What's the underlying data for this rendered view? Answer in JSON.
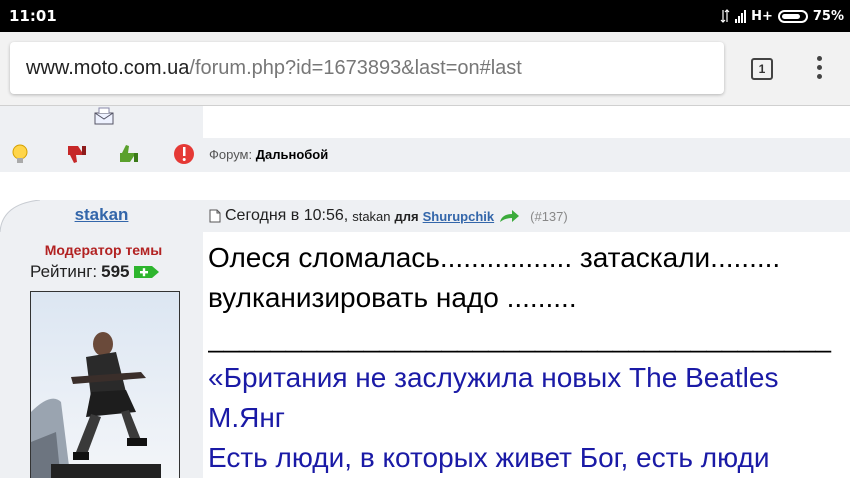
{
  "status_bar": {
    "time": "11:01",
    "network": "H+",
    "battery": "75%"
  },
  "browser": {
    "url_domain": "www.moto.com.ua",
    "url_path": "/forum.php?id=1673893&last=on#last",
    "tab_count": "1"
  },
  "prev_post": {
    "forum_label": "Форум:",
    "forum_name": "Дальнобой",
    "icons": [
      "mail-icon",
      "lightbulb-icon",
      "thumbs-down-icon",
      "thumbs-up-icon",
      "warning-icon"
    ]
  },
  "post": {
    "username": "stakan",
    "role": "Модератор темы",
    "rating_label": "Рейтинг:",
    "rating_value": "595",
    "date": "Сегодня в 10:56,",
    "author": "stakan",
    "for_word": "для",
    "reply_to": "Shurupchik",
    "post_number": "(#137)",
    "text_line1": "Олеся сломалась................. затаскали.........",
    "text_line2": "вулканизировать надо .........",
    "separator": "________________________________________",
    "sig_line1": "«Британия не заслужила новых The Beatles",
    "sig_line2": "М.Янг",
    "sig_line3": "Есть люди, в которых живет Бог, есть люди"
  },
  "colors": {
    "link": "#3366aa",
    "moderator": "#b22222",
    "signature": "#1a1aa6",
    "panel_bg": "#eef0f3"
  }
}
